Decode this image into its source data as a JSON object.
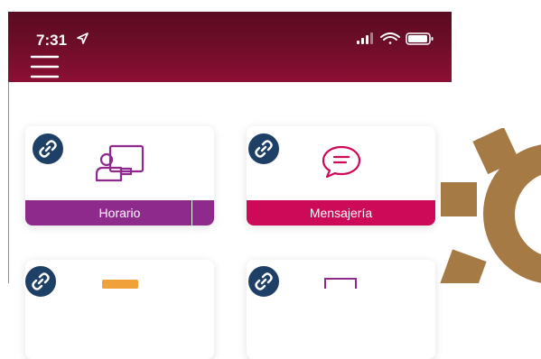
{
  "status_bar": {
    "time": "7:31",
    "location_icon": "location-arrow-icon",
    "signal_icon": "signal-bars-icon",
    "wifi_icon": "wifi-icon",
    "battery_icon": "battery-icon"
  },
  "header": {
    "menu_icon": "hamburger-menu-icon",
    "bar_color": "#6d0d28"
  },
  "tiles": [
    {
      "label": "Horario",
      "icon": "teacher-board-icon",
      "badge_icon": "link-icon",
      "color": "#8e2a8c"
    },
    {
      "label": "Mensajería",
      "icon": "chat-bubble-icon",
      "badge_icon": "link-icon",
      "color": "#cc0a57"
    },
    {
      "label": "",
      "icon": "card-icon",
      "badge_icon": "link-icon",
      "color": "#f0a13a"
    },
    {
      "label": "",
      "icon": "card-icon",
      "badge_icon": "link-icon",
      "color": "#8e2a8c"
    }
  ],
  "decoration": {
    "gear_color": "#a67a45"
  }
}
